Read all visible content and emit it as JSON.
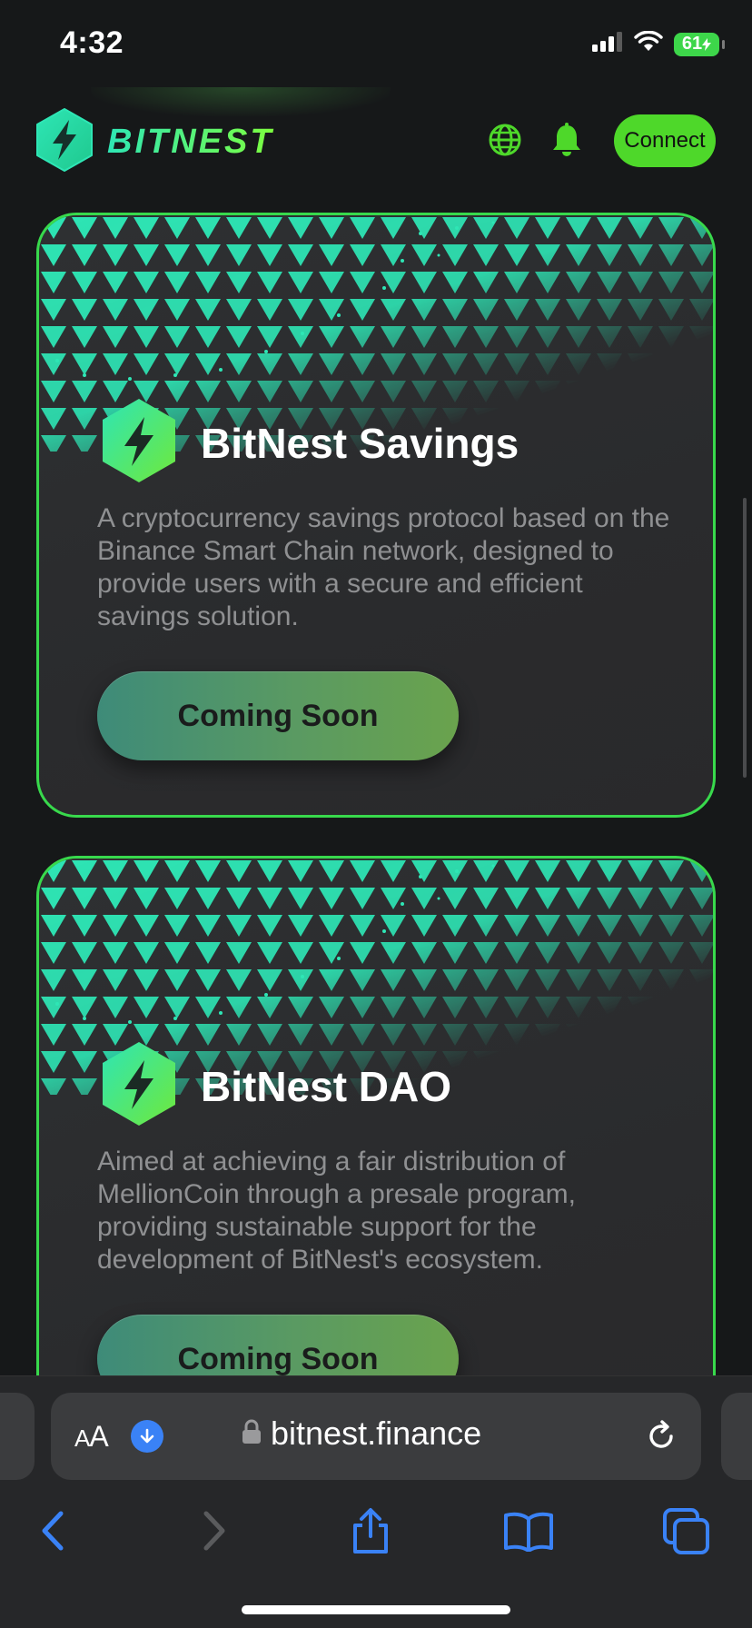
{
  "status_bar": {
    "time": "4:32",
    "battery": "61"
  },
  "header": {
    "logo_text": "BITNEST",
    "connect_label": "Connect"
  },
  "cards": [
    {
      "title": "BitNest Savings",
      "description": "A cryptocurrency savings protocol based on the Binance Smart Chain network, designed to provide users with a secure and efficient savings solution.",
      "button_label": "Coming Soon"
    },
    {
      "title": "BitNest DAO",
      "description": "Aimed at achieving a fair distribution of MellionCoin through a presale program, providing sustainable support for the development of BitNest's ecosystem.",
      "button_label": "Coming Soon"
    }
  ],
  "browser": {
    "aa_large": "A",
    "aa_small": "A",
    "url": "bitnest.finance"
  },
  "colors": {
    "accent_green": "#4ed82a",
    "card_border": "#38d94c",
    "teal": "#2ee6b5",
    "background": "#161819",
    "ios_blue": "#3a82f6"
  },
  "icons": [
    "signal-icon",
    "wifi-icon",
    "battery-icon",
    "bitnest-logo-icon",
    "globe-icon",
    "bell-icon",
    "download-icon",
    "lock-icon",
    "reload-icon",
    "back-icon",
    "forward-icon",
    "share-icon",
    "bookmarks-icon",
    "tabs-icon"
  ]
}
